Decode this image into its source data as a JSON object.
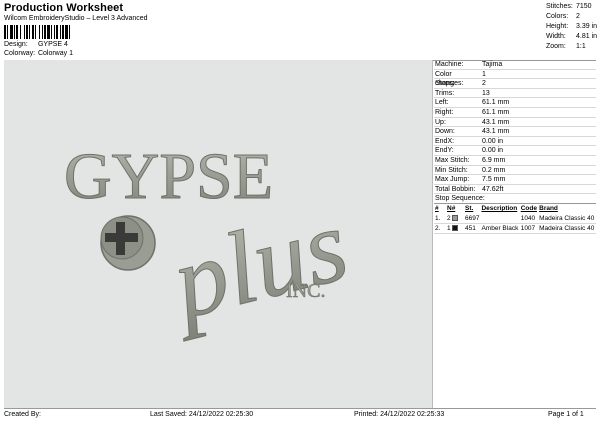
{
  "header": {
    "title": "Production Worksheet",
    "subtitle": "Wilcom EmbroideryStudio – Level 3 Advanced",
    "design_label": "Design:",
    "design_value": "GYPSE 4",
    "colorway_label": "Colorway:",
    "colorway_value": "Colorway 1"
  },
  "stats": [
    {
      "label": "Stitches:",
      "value": "7150"
    },
    {
      "label": "Colors:",
      "value": "2"
    },
    {
      "label": "Height:",
      "value": "3.39 in"
    },
    {
      "label": "Width:",
      "value": "4.81 in"
    },
    {
      "label": "Zoom:",
      "value": "1:1"
    }
  ],
  "design": {
    "word1": "GYPSE",
    "word2": "plus",
    "word3": "INC.",
    "thread_color": "#9a9d93",
    "background_color": "#e3e4e4"
  },
  "machine_info": [
    {
      "label": "Machine:",
      "value": "Tajima"
    },
    {
      "label": "Color changes:",
      "value": "1"
    },
    {
      "label": "Stops:",
      "value": "2"
    },
    {
      "label": "Trims:",
      "value": "13"
    },
    {
      "label": "Left:",
      "value": "61.1 mm"
    },
    {
      "label": "Right:",
      "value": "61.1 mm"
    },
    {
      "label": "Up:",
      "value": "43.1 mm"
    },
    {
      "label": "Down:",
      "value": "43.1 mm"
    },
    {
      "label": "EndX:",
      "value": "0.00 in"
    },
    {
      "label": "EndY:",
      "value": "0.00 in"
    },
    {
      "label": "Max Stitch:",
      "value": "6.9 mm"
    },
    {
      "label": "Min Stitch:",
      "value": "0.2 mm"
    },
    {
      "label": "Max Jump:",
      "value": "7.5 mm"
    },
    {
      "label": "Total Bobbin:",
      "value": "47.62ft"
    }
  ],
  "stop_sequence": {
    "title": "Stop Sequence:",
    "headers": [
      "#",
      "N#",
      "St.",
      "Description",
      "Code",
      "Brand"
    ],
    "rows": [
      {
        "idx": "1.",
        "n": "2",
        "color": "#9a9d93",
        "st": "6697",
        "desc": "",
        "code": "1040",
        "brand": "Madeira Classic 40"
      },
      {
        "idx": "2.",
        "n": "1",
        "color": "#111111",
        "st": "451",
        "desc": "Amber Black",
        "code": "1007",
        "brand": "Madeira Classic 40"
      }
    ]
  },
  "footer": {
    "created_by": "Created By:",
    "last_saved": "Last Saved: 24/12/2022 02:25:30",
    "printed": "Printed: 24/12/2022 02:25:33",
    "page": "Page 1 of 1"
  }
}
